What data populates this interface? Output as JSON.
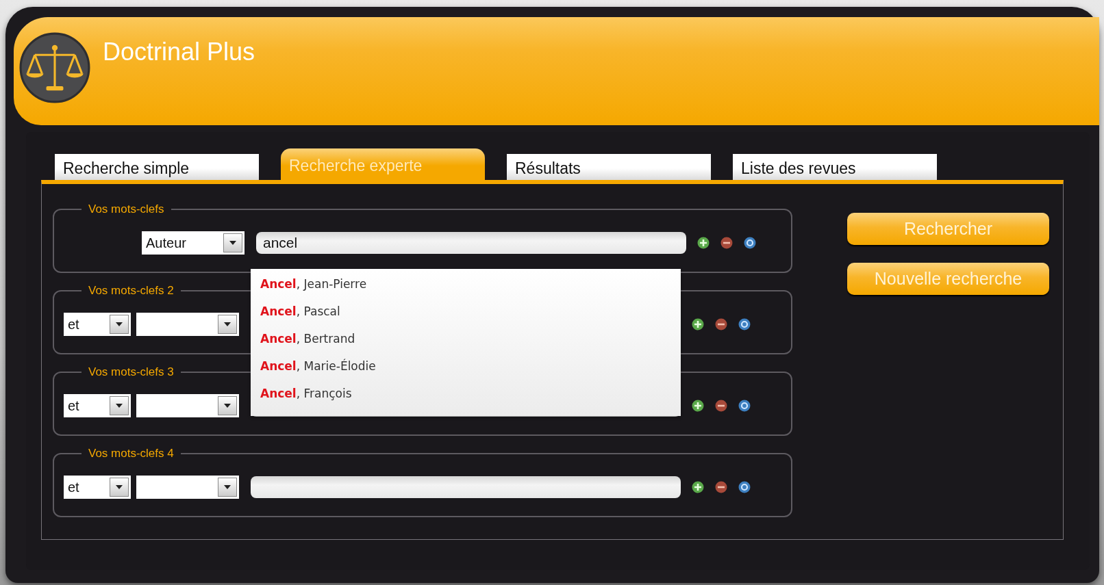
{
  "app": {
    "title": "Doctrinal Plus"
  },
  "tabs": [
    {
      "label": "Recherche simple",
      "selected": false
    },
    {
      "label": "Recherche experte",
      "selected": true
    },
    {
      "label": "Résultats",
      "selected": false
    },
    {
      "label": "Liste des revues",
      "selected": false
    }
  ],
  "keyword_groups": [
    {
      "legend": "Vos mots-clefs",
      "field": "Auteur",
      "value": "ancel"
    },
    {
      "legend": "Vos mots-clefs 2",
      "operator": "et"
    },
    {
      "legend": "Vos mots-clefs 3",
      "operator": "et"
    },
    {
      "legend": "Vos mots-clefs 4",
      "operator": "et"
    }
  ],
  "suggestions": [
    {
      "match": "Ancel",
      "rest": ", Jean-Pierre"
    },
    {
      "match": "Ancel",
      "rest": ", Pascal"
    },
    {
      "match": "Ancel",
      "rest": ", Bertrand"
    },
    {
      "match": "Ancel",
      "rest": ", Marie-Élodie"
    },
    {
      "match": "Ancel",
      "rest": ", François"
    }
  ],
  "buttons": [
    "Rechercher",
    "Nouvelle recherche"
  ]
}
